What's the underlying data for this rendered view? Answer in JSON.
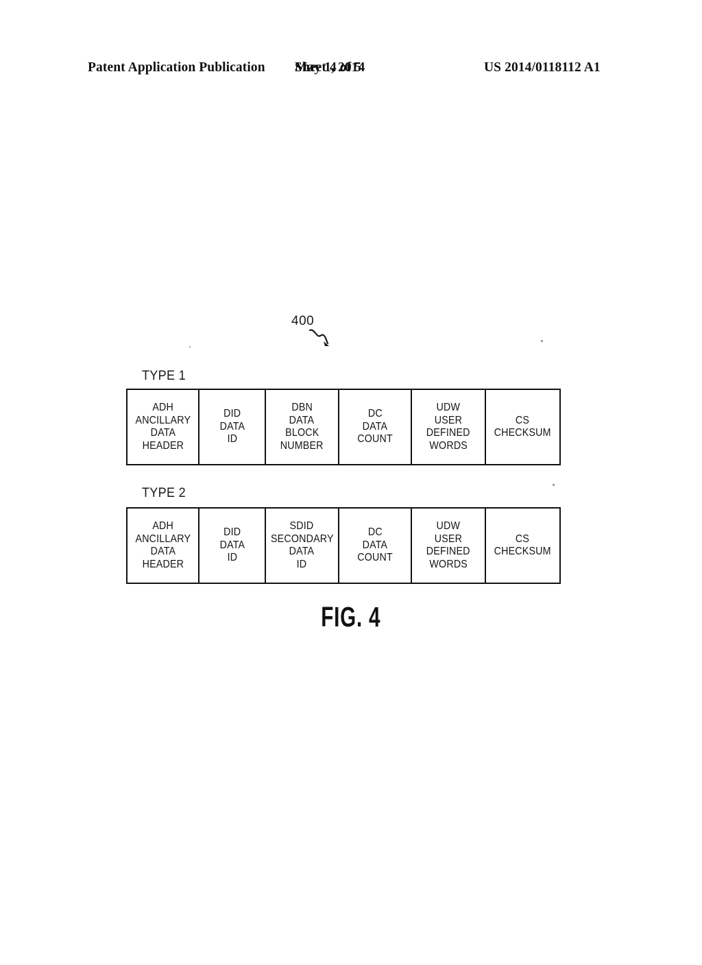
{
  "header": {
    "left": "Patent Application Publication",
    "date": "May 1, 2014",
    "sheet": "Sheet 4 of 5",
    "patent_number": "US 2014/0118112 A1"
  },
  "figure": {
    "caption": "FIG. 4",
    "reference_numeral": "400",
    "lead_line_icon": "squiggle-arrow-icon"
  },
  "diagram": {
    "type": "ancillary-data-packet-format",
    "rows": [
      {
        "label": "TYPE 1",
        "cells": [
          {
            "name": "adh",
            "lines": [
              "ADH",
              "ANCILLARY",
              "DATA",
              "HEADER"
            ]
          },
          {
            "name": "did",
            "lines": [
              "DID",
              "DATA",
              "ID"
            ]
          },
          {
            "name": "dbn",
            "lines": [
              "DBN",
              "DATA",
              "BLOCK",
              "NUMBER"
            ]
          },
          {
            "name": "dc",
            "lines": [
              "DC",
              "DATA",
              "COUNT"
            ]
          },
          {
            "name": "udw",
            "lines": [
              "UDW",
              "USER",
              "DEFINED",
              "WORDS"
            ]
          },
          {
            "name": "cs",
            "lines": [
              "CS",
              "CHECKSUM"
            ]
          }
        ]
      },
      {
        "label": "TYPE 2",
        "cells": [
          {
            "name": "adh",
            "lines": [
              "ADH",
              "ANCILLARY",
              "DATA",
              "HEADER"
            ]
          },
          {
            "name": "did",
            "lines": [
              "DID",
              "DATA",
              "ID"
            ]
          },
          {
            "name": "sdid",
            "lines": [
              "SDID",
              "SECONDARY",
              "DATA",
              "ID"
            ]
          },
          {
            "name": "dc",
            "lines": [
              "DC",
              "DATA",
              "COUNT"
            ]
          },
          {
            "name": "udw",
            "lines": [
              "UDW",
              "USER",
              "DEFINED",
              "WORDS"
            ]
          },
          {
            "name": "cs",
            "lines": [
              "CS",
              "CHECKSUM"
            ]
          }
        ]
      }
    ]
  },
  "colors": {
    "ink": "#111111",
    "paper": "#ffffff"
  }
}
